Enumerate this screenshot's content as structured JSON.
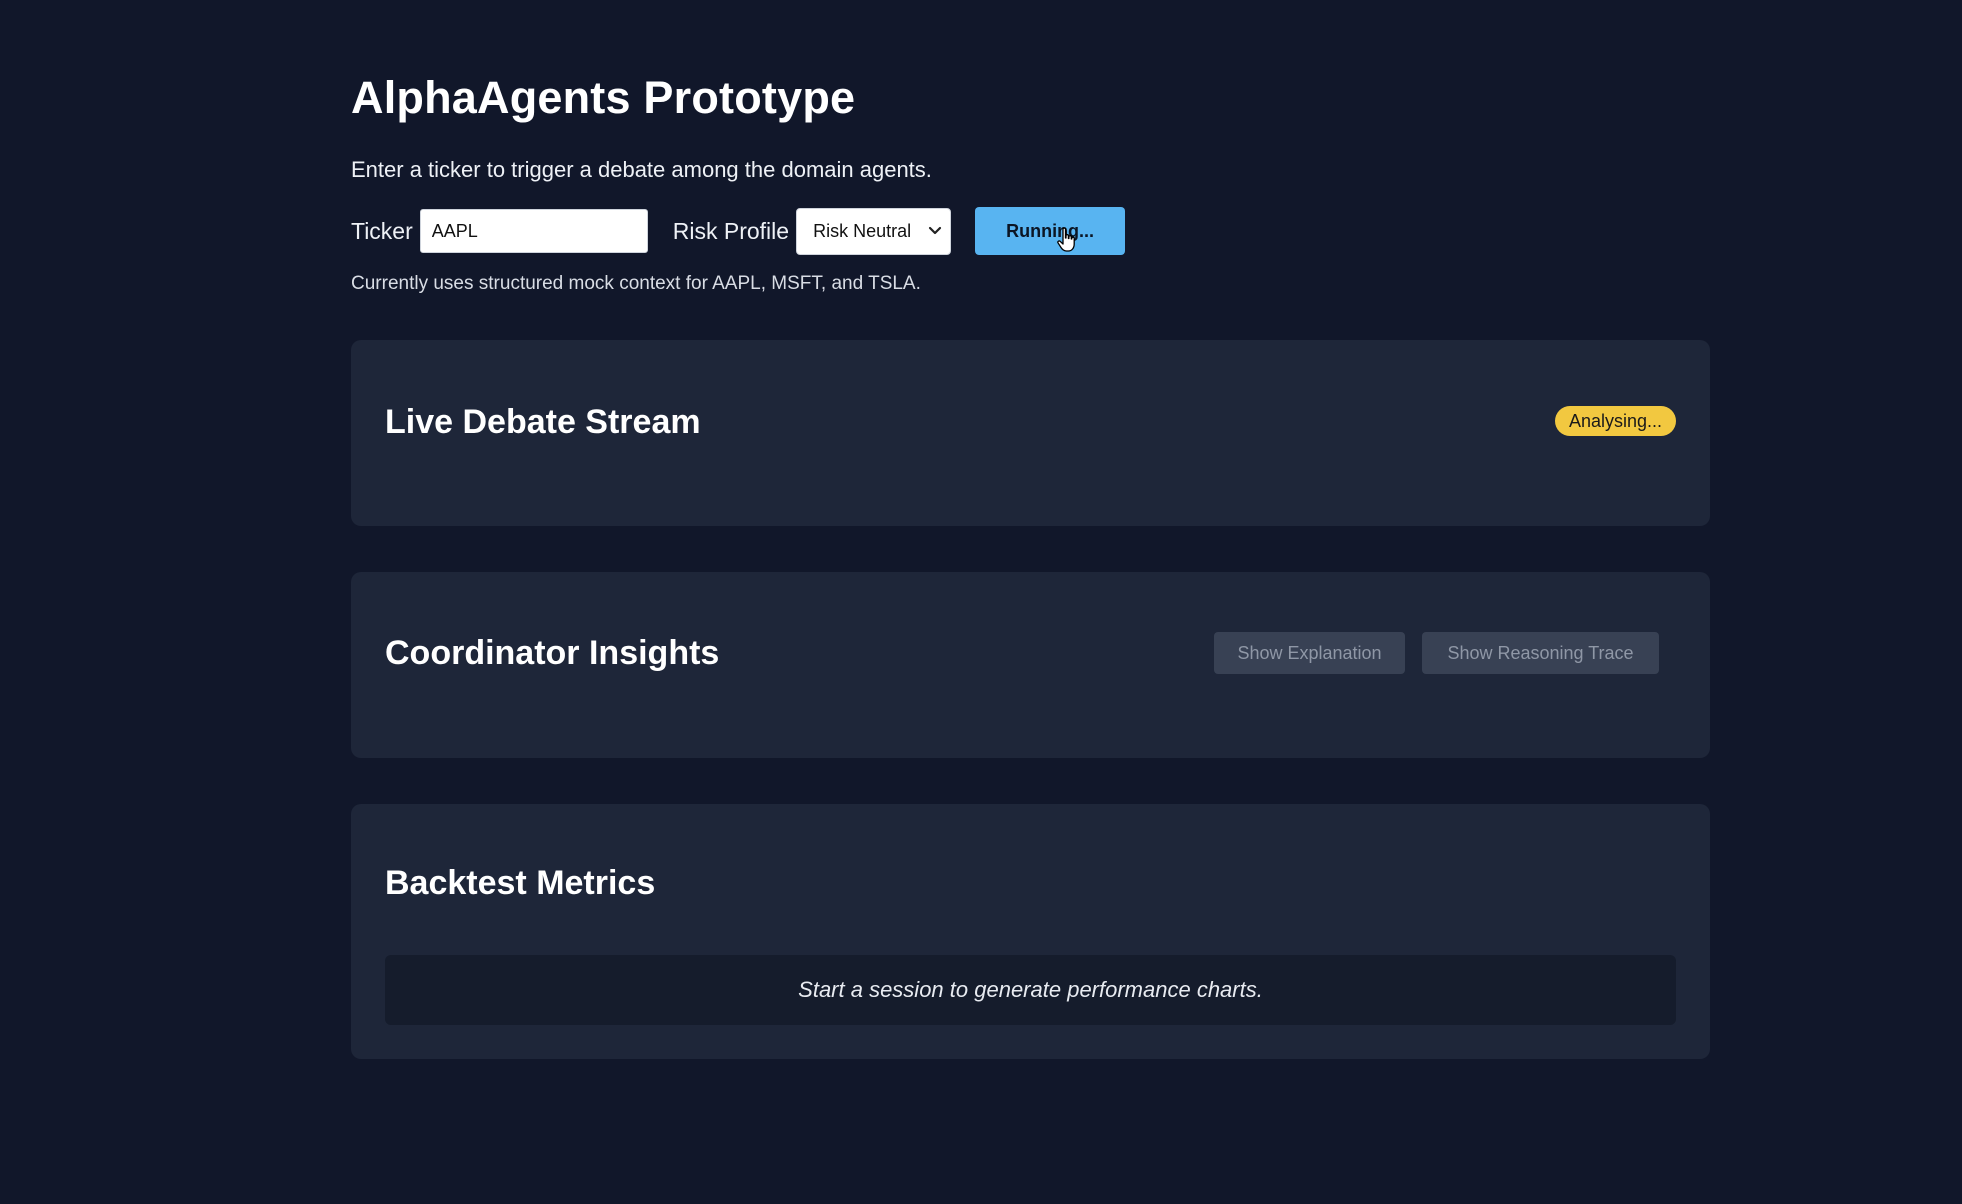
{
  "header": {
    "title": "AlphaAgents Prototype",
    "subtitle": "Enter a ticker to trigger a debate among the domain agents."
  },
  "controls": {
    "ticker_label": "Ticker",
    "ticker_value": "AAPL",
    "risk_label": "Risk Profile",
    "risk_selected": "Risk Neutral",
    "run_button_label": "Running...",
    "note": "Currently uses structured mock context for AAPL, MSFT, and TSLA."
  },
  "panels": {
    "debate": {
      "title": "Live Debate Stream",
      "status_badge": "Analysing..."
    },
    "coordinator": {
      "title": "Coordinator Insights",
      "explanation_button": "Show Explanation",
      "trace_button": "Show Reasoning Trace"
    },
    "backtest": {
      "title": "Backtest Metrics",
      "empty_message": "Start a session to generate performance charts."
    }
  },
  "colors": {
    "background": "#11172a",
    "panel": "#1e2639",
    "accent_button": "#58b4f1",
    "status_badge": "#f2c840"
  },
  "icons": {
    "select_chevron": "chevron-down-icon",
    "cursor": "hand-pointer-icon"
  }
}
